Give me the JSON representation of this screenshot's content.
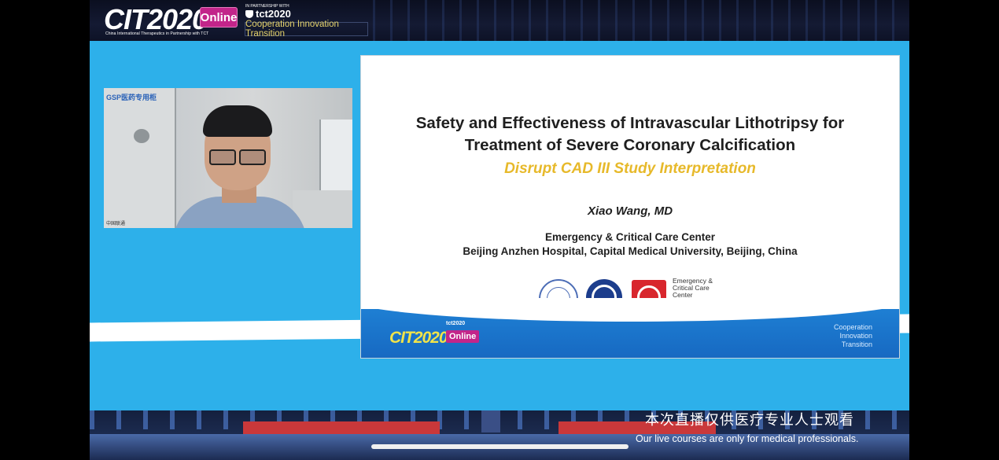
{
  "header": {
    "cit_logo": "CIT2020",
    "cit_subtitle": "China International Therapeutics in Partnership with TCT",
    "online_badge": "Online",
    "partner_text": "IN PARTNERSHIP WITH",
    "tct_logo": "tct2020",
    "tagline": "Cooperation Innovation Transition"
  },
  "presenter_video": {
    "cabinet_label": "GSP医药专用柜",
    "signal_text": "中国联通"
  },
  "slide": {
    "title_line1": "Safety and Effectiveness of Intravascular Lithotripsy for",
    "title_line2": "Treatment of Severe Coronary Calcification",
    "subtitle": "Disrupt CAD III Study Interpretation",
    "author": "Xiao Wang, MD",
    "department_line1": "Emergency & Critical Care Center",
    "department_line2": "Beijing Anzhen Hospital, Capital Medical University, Beijing, China",
    "logo_text_line1": "Emergency &",
    "logo_text_line2": "Critical Care",
    "logo_text_line3": "Center",
    "footer_cit": "CIT2020",
    "footer_online": "Online",
    "footer_tct": "tct2020",
    "footer_tagline_1": "Cooperation",
    "footer_tagline_2": "Innovation",
    "footer_tagline_3": "Transition"
  },
  "captions": {
    "chinese": "本次直播仅供医疗专业人士观看",
    "english": "Our live courses are only for medical professionals."
  },
  "colors": {
    "background_blue": "#2db0ea",
    "subtitle_yellow": "#e7b92a",
    "online_magenta": "#c2258a",
    "footer_blue": "#1e7fd3"
  }
}
